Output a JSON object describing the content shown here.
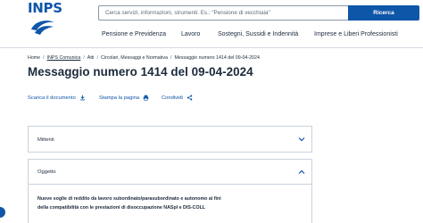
{
  "brand": {
    "logo_text": "INPS",
    "accent": "#0e56a8"
  },
  "search": {
    "placeholder": "Cerca servizi, informazioni, strumenti. Es.: \"Pensione di vecchiaia\"",
    "button_label": "Ricerca",
    "button_icon": "search-icon"
  },
  "nav": {
    "items": [
      "Pensione e Previdenza",
      "Lavoro",
      "Sostegni, Sussidi e Indennità",
      "Imprese e Liberi Professionisti"
    ]
  },
  "breadcrumb": [
    "Home",
    "INPS Comunica",
    "Atti",
    "Circolari, Messaggi e Normativa",
    "Messaggio numero 1414 del 09-04-2024"
  ],
  "page": {
    "title": "Messaggio numero 1414 del 09-04-2024"
  },
  "actions": [
    {
      "label": "Scarica il documento",
      "icon": "download-icon"
    },
    {
      "label": "Stampa la pagina",
      "icon": "print-icon"
    },
    {
      "label": "Condividi",
      "icon": "share-icon"
    }
  ],
  "accordions": [
    {
      "title": "Mittenti",
      "expanded": false
    },
    {
      "title": "Oggetto",
      "expanded": true,
      "body_lines": [
        "Nuove soglie di reddito da lavoro subordinato/parasubordinato e autonomo ai fini",
        "della compatibilità con le prestazioni di disoccupazione NASpI e DIS-COLL"
      ]
    }
  ]
}
